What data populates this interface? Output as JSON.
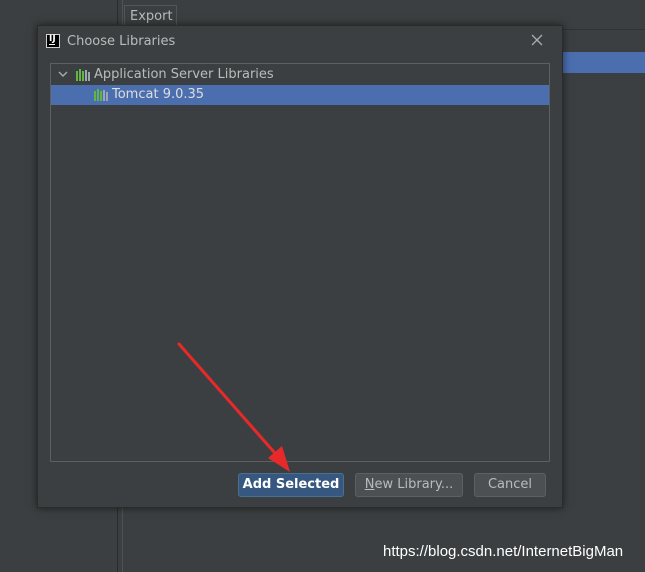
{
  "background": {
    "export_tab_label": "Export"
  },
  "dialog": {
    "title": "Choose Libraries",
    "app_icon": "intellij-idea-icon",
    "close_icon": "close-icon",
    "tree": {
      "group": {
        "label": "Application Server Libraries",
        "icon": "library-icon",
        "expanded": true
      },
      "items": [
        {
          "label": "Tomcat 9.0.35",
          "icon": "library-icon",
          "selected": true
        }
      ]
    },
    "buttons": {
      "add_selected": "Add Selected",
      "new_library_first": "N",
      "new_library_rest": "ew Library...",
      "cancel": "Cancel"
    }
  },
  "colors": {
    "window_bg": "#3c3f41",
    "selection": "#4b6eaf",
    "default_button": "#365880",
    "annotation_arrow": "#e8292a"
  },
  "watermark": "https://blog.csdn.net/InternetBigMan"
}
